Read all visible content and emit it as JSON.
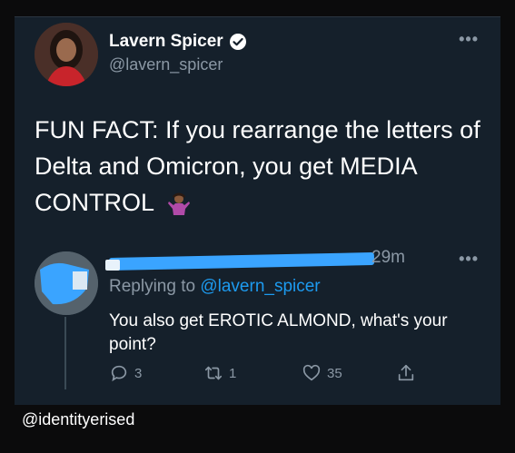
{
  "tweet": {
    "author_name": "Lavern Spicer",
    "author_handle": "@lavern_spicer",
    "more_label": "•••",
    "text": "FUN FACT: If you rearrange the letters of Delta and Omicron, you get MEDIA CONTROL"
  },
  "reply": {
    "time": "29m",
    "replying_prefix": "Replying to",
    "replying_handle": "@lavern_spicer",
    "text": "You also get EROTIC ALMOND, what's your point?",
    "more_label": "•••",
    "replies_count": "3",
    "retweets_count": "1",
    "likes_count": "35"
  },
  "watermark": "@identityerised",
  "colors": {
    "background": "#15202b",
    "text": "#ffffff",
    "muted": "#8b98a5",
    "link": "#1d9bf0",
    "redaction": "#3aa4ff"
  },
  "icons": [
    "verified-badge-icon",
    "shrug-emoji-icon",
    "reply-icon",
    "retweet-icon",
    "like-icon",
    "share-icon",
    "more-icon"
  ]
}
